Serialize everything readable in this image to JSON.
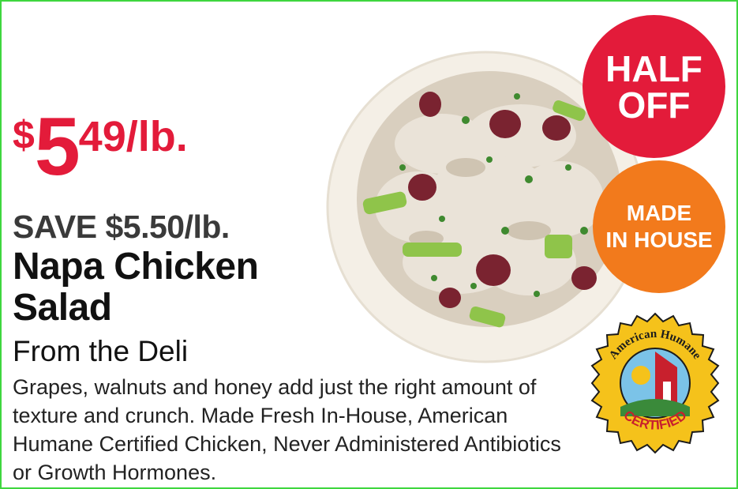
{
  "price": {
    "currency": "$",
    "dollars": "5",
    "cents_unit": "49/lb."
  },
  "savings": "SAVE $5.50/lb.",
  "product": {
    "name_line1": "Napa Chicken",
    "name_line2": "Salad",
    "source": "From the Deli",
    "description": "Grapes, walnuts and honey add just the right amount of texture and crunch. Made Fresh In-House, American Humane Certified Chicken, Never Administered Antibiotics or Growth Hormones."
  },
  "badges": {
    "half_off": [
      "HALF",
      "OFF"
    ],
    "made_in_house": [
      "MADE",
      "IN HOUSE"
    ]
  },
  "seal": {
    "top_text": "American Humane",
    "bottom_text": "CERTIFIED"
  },
  "colors": {
    "price_red": "#e31b3a",
    "badge_red": "#e31b3a",
    "badge_orange": "#f27a1c",
    "seal_gold": "#f5c21b",
    "border_green": "#3ed63e"
  }
}
